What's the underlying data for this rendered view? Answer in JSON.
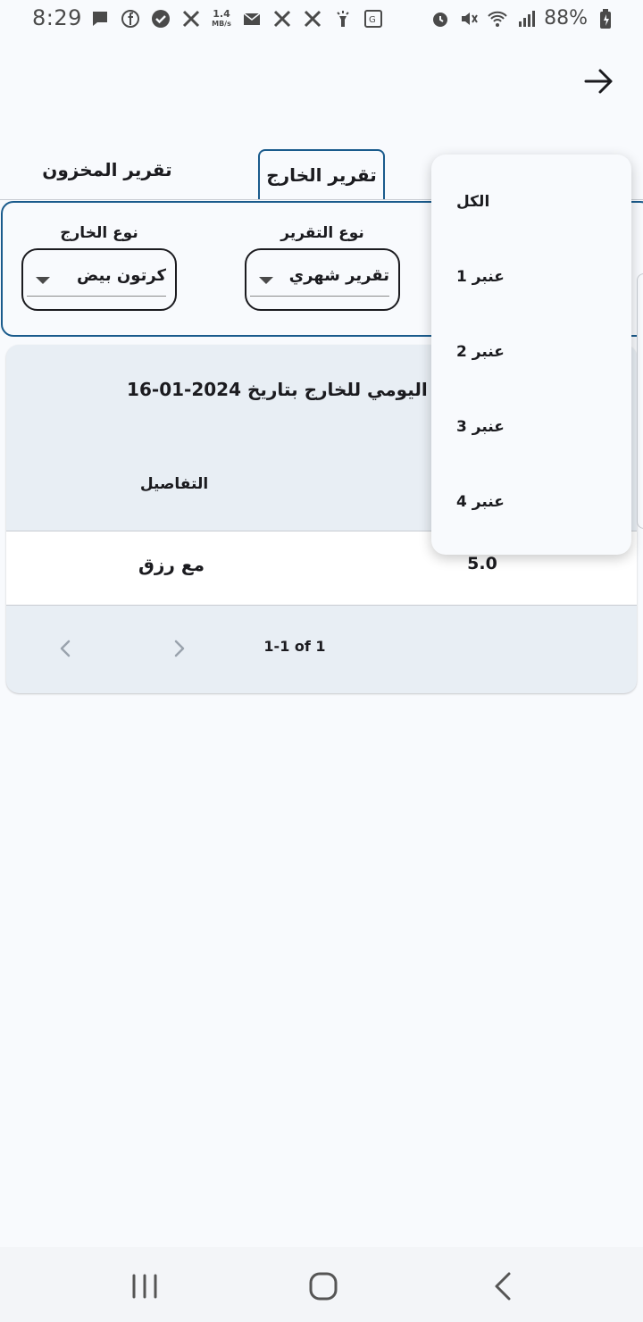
{
  "status_bar": {
    "time": "8:29",
    "speed_value": "1.4",
    "speed_unit": "MB/s",
    "battery": "88%",
    "icons_left": [
      "message-icon",
      "facebook-icon",
      "check-circle-icon",
      "x-icon",
      "speed-indicator",
      "mail-icon",
      "x-icon",
      "x-icon",
      "flashlight-icon",
      "translate-icon"
    ],
    "icons_right": [
      "alarm-icon",
      "mute-icon",
      "wifi-icon",
      "signal-icon",
      "battery-icon"
    ]
  },
  "tabs": {
    "inventory_report": "تقرير المخزون",
    "output_report": "تقرير الخارج"
  },
  "filters": {
    "output_type_label": "نوع الخارج",
    "output_type_value": "كرتون بيض",
    "report_type_label": "نوع التقرير",
    "report_type_value": "تقرير شهري"
  },
  "report": {
    "title": "تقرير اليومي للخارج بتاريخ 2024-01-16",
    "column_details": "التفاصيل",
    "rows": [
      {
        "details": "مع رزق",
        "quantity": "5.0"
      }
    ],
    "pagination": "1-1 of 1"
  },
  "dropdown": {
    "items": [
      "الكل",
      "عنبر 1",
      "عنبر 2",
      "عنبر 3",
      "عنبر 4"
    ]
  },
  "colors": {
    "accent": "#1a5b8c",
    "background": "#f8fafd",
    "card": "#e8eef4"
  }
}
